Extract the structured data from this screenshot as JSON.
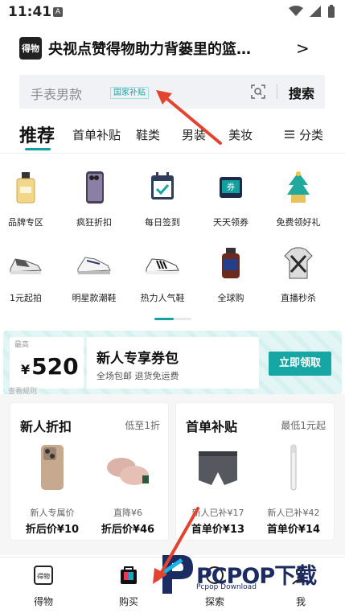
{
  "status_bar": {
    "time": "11:41",
    "sim": "A"
  },
  "banner": {
    "logo": "得物",
    "title": "央视点赞得物助力背篓里的篮…",
    "chevron": ">"
  },
  "search": {
    "placeholder": "手表男款",
    "tag": "国家补贴",
    "button": "搜索"
  },
  "tabs": {
    "items": [
      "推荐",
      "首单补贴",
      "鞋类",
      "男装",
      "美妆"
    ],
    "active": "推荐",
    "category_label": "分类"
  },
  "grid": {
    "items": [
      {
        "label": "品牌专区",
        "icon": "perfume-icon"
      },
      {
        "label": "疯狂折扣",
        "icon": "phone-icon"
      },
      {
        "label": "每日签到",
        "icon": "calendar-check-icon"
      },
      {
        "label": "天天领券",
        "icon": "coupon-icon"
      },
      {
        "label": "免费领好礼",
        "icon": "gift-tree-icon"
      },
      {
        "label": "1元起拍",
        "icon": "sneaker-icon"
      },
      {
        "label": "明星款潮鞋",
        "icon": "running-shoe-icon"
      },
      {
        "label": "热力人气鞋",
        "icon": "adidas-shoe-icon"
      },
      {
        "label": "全球购",
        "icon": "supplement-bottle-icon"
      },
      {
        "label": "直播秒杀",
        "icon": "jersey-icon"
      }
    ]
  },
  "coupon": {
    "top_label": "最高",
    "currency": "¥",
    "amount": "520",
    "title": "新人专享券包",
    "subtitle": "全场包邮  退货免运费",
    "button": "立即领取",
    "rules": "查看规则"
  },
  "cards": [
    {
      "title": "新人折扣",
      "subtitle": "低至1折",
      "products": [
        {
          "label": "新人专属价",
          "price": "折后价¥10",
          "icon": "iphone-icon"
        },
        {
          "label": "直降¥6",
          "price": "折后价¥46",
          "icon": "slippers-icon"
        }
      ]
    },
    {
      "title": "首单补贴",
      "subtitle": "最低1元起",
      "products": [
        {
          "label": "新人已补¥17",
          "price": "首单价¥13",
          "icon": "underwear-icon"
        },
        {
          "label": "新人已补¥42",
          "price": "首单价¥14",
          "icon": "toothbrush-icon"
        }
      ]
    }
  ],
  "bottom_nav": [
    {
      "label": "得物",
      "icon": "home-logo-icon"
    },
    {
      "label": "购买",
      "icon": "shopping-bag-icon"
    },
    {
      "label": "探索",
      "icon": "explore-icon"
    },
    {
      "label": "我",
      "icon": "profile-icon"
    }
  ],
  "watermark": {
    "brand": "PCPOP下载",
    "sub": "Pcpop Download"
  },
  "colors": {
    "accent": "#13a4a1",
    "arrow": "#e3432f",
    "text": "#111111"
  }
}
